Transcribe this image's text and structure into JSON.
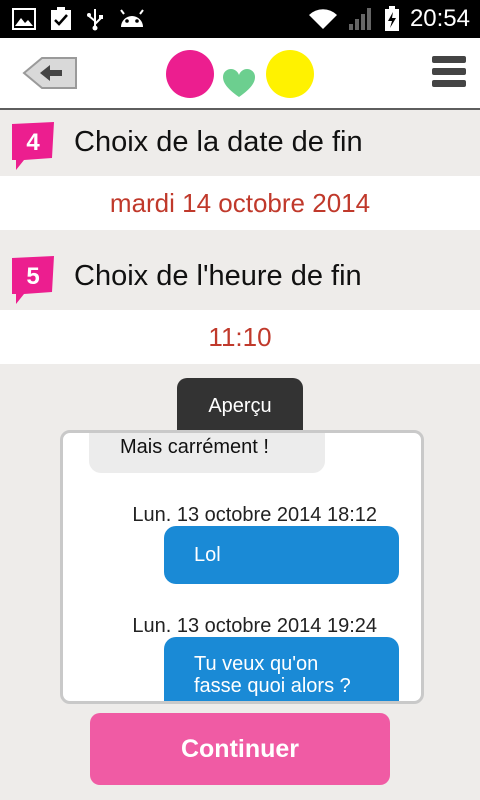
{
  "status_bar": {
    "time": "20:54",
    "icons": [
      "image-icon",
      "clipboard-check-icon",
      "usb-icon",
      "android-icon",
      "wifi-icon",
      "signal-icon",
      "battery-charging-icon"
    ]
  },
  "header": {
    "back_icon": "back-arrow-icon",
    "menu_icon": "hamburger-menu-icon",
    "logo_colors": [
      "#ec1e8f",
      "#6ccf8f",
      "#fff200"
    ]
  },
  "steps": [
    {
      "number": "4",
      "title": "Choix de la date de fin",
      "value": "mardi 14 octobre 2014"
    },
    {
      "number": "5",
      "title": "Choix de l'heure de fin",
      "value": "11:10"
    }
  ],
  "preview": {
    "tab_label": "Aperçu",
    "incoming_message": "Mais carrément !",
    "messages": [
      {
        "timestamp": "Lun. 13 octobre 2014 18:12",
        "text": "Lol"
      },
      {
        "timestamp": "Lun. 13 octobre 2014 19:24",
        "text": "Tu veux qu'on fasse quoi alors ?"
      }
    ]
  },
  "continue_label": "Continuer",
  "colors": {
    "accent_pink": "#f05ba4",
    "badge_pink": "#ec1e8f",
    "value_red": "#c0392b",
    "bubble_blue": "#1a8ad6"
  }
}
